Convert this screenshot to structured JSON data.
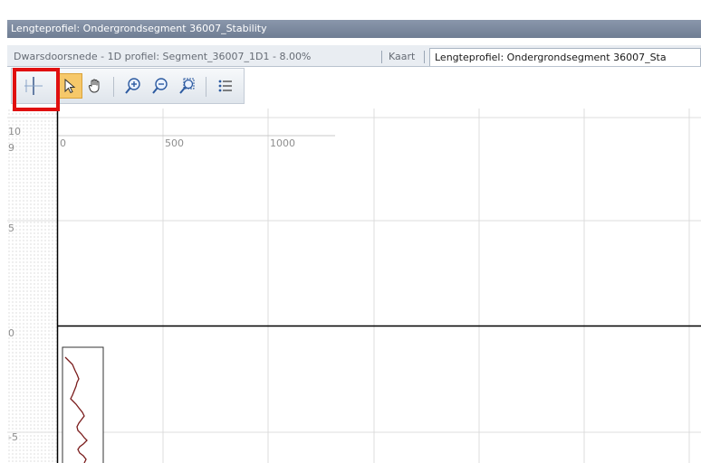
{
  "window": {
    "title": "Lengteprofiel: Ondergrondsegment 36007_Stability"
  },
  "tabs": [
    {
      "label": "Dwarsdoorsnede - 1D profiel: Segment_36007_1D1 - 8.00%",
      "active": false
    },
    {
      "label": "Kaart",
      "active": false
    },
    {
      "label": "Lengteprofiel: Ondergrondsegment 36007_Sta",
      "active": true
    }
  ],
  "toolbar": {
    "buttons": [
      {
        "icon": "vertical-line-tool-icon",
        "highlighted": true
      },
      {
        "icon": "select-arrow-icon",
        "selected": true
      },
      {
        "icon": "pan-hand-icon"
      },
      {
        "icon": "zoom-in-icon"
      },
      {
        "icon": "zoom-out-icon"
      },
      {
        "icon": "zoom-extent-icon"
      },
      {
        "icon": "legend-list-icon"
      }
    ],
    "highlight_color": "#e01010"
  },
  "plot": {
    "y_labels": [
      "10",
      "9",
      "5",
      "0",
      "-5"
    ],
    "x_labels": [
      "0",
      "500",
      "1000"
    ],
    "grid_color": "#dcdcdc",
    "profile_line_color": "#7a1c1c"
  }
}
